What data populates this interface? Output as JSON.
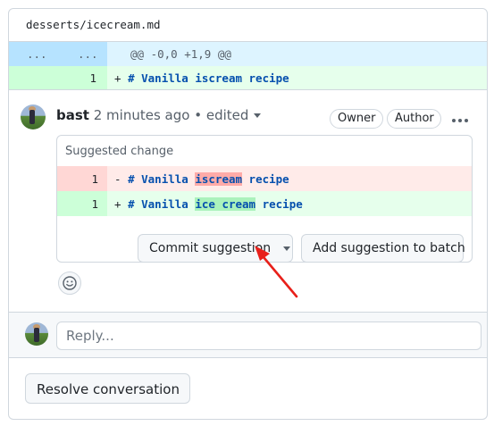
{
  "file": {
    "path": "desserts/icecream.md"
  },
  "diff": {
    "hunk": {
      "left_num": "...",
      "right_num": "...",
      "header": "@@ -0,0 +1,9 @@"
    },
    "added_line": {
      "line_number": "1",
      "sign": "+",
      "hash": "#",
      "text": "Vanilla iscream recipe"
    }
  },
  "comment": {
    "author": "bast",
    "timestamp": "2 minutes ago",
    "separator": "•",
    "edited": "edited",
    "labels": [
      "Owner",
      "Author"
    ],
    "suggestion": {
      "title": "Suggested change",
      "removed": {
        "line_number": "1",
        "sign": "-",
        "hash": "#",
        "pre": "Vanilla ",
        "highlight": "iscream",
        "post": " recipe"
      },
      "added": {
        "line_number": "1",
        "sign": "+",
        "hash": "#",
        "pre": "Vanilla ",
        "highlight": "ice cream",
        "post": " recipe"
      },
      "commit_button": "Commit suggestion",
      "batch_button": "Add suggestion to batch"
    }
  },
  "reply": {
    "placeholder": "Reply..."
  },
  "resolve_button": "Resolve conversation",
  "colors": {
    "annotation_arrow": "#e8201a",
    "added_bg": "#e6ffec",
    "removed_bg": "#ffebe9",
    "hunk_bg": "#ddf4ff"
  },
  "icons": [
    "caret-down-icon",
    "kebab-icon",
    "smiley-icon",
    "avatar"
  ]
}
